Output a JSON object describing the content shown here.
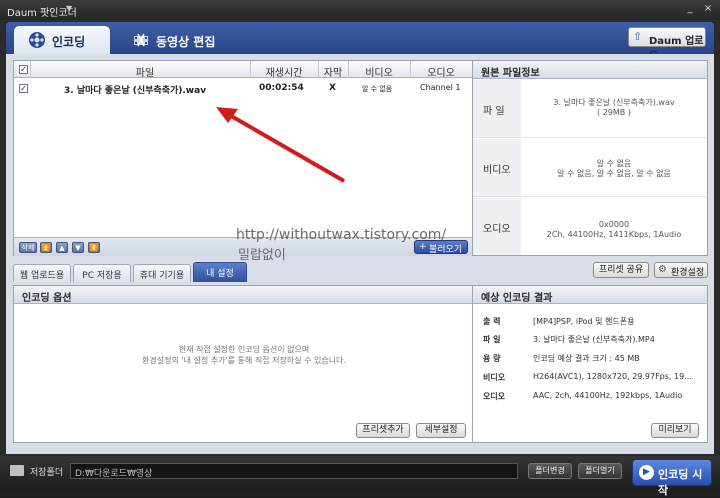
{
  "window": {
    "title": "Daum 팟인코더",
    "controls": {
      "minimize": "_",
      "close": "×"
    }
  },
  "main_tabs": {
    "encoding": "인코딩",
    "video_edit": "동영상 편집",
    "update_button": "Daum 업로드"
  },
  "file_list": {
    "columns": [
      "파일",
      "재생시간",
      "자막",
      "비디오",
      "오디오"
    ],
    "rows": [
      {
        "checked": true,
        "file": "3. 날마다 좋은날 (신부측축가).wav",
        "duration": "00:02:54",
        "subtitle": "X",
        "video": "알 수 없음",
        "audio": "Channel 1"
      }
    ],
    "footer": {
      "delete": "삭제",
      "browse_button": "불러오기"
    }
  },
  "original_info": {
    "title": "원본 파일정보",
    "rows": [
      {
        "label": "파 일",
        "value": "3. 날마다 좋은날 (신부측축가).wav\n( 29MB )"
      },
      {
        "label": "비디오",
        "value": "알 수 없음\n알 수 없음, 알 수 없음, 알 수 없음"
      },
      {
        "label": "오디오",
        "value": "0x0000\n2Ch, 44100Hz, 1411Kbps, 1Audio"
      }
    ]
  },
  "watermark": {
    "url": "http://withoutwax.tistory.com/",
    "name": "밀랍없이"
  },
  "option_tabs": [
    "웹 업로드용",
    "PC 저장용",
    "휴대 기기용",
    "내 설정"
  ],
  "option_buttons": {
    "preset_share": "프리셋 공유",
    "env_settings": "환경설정"
  },
  "encoding_options": {
    "title": "인코딩 옵션",
    "message_line1": "현재 직접 설정한 인코딩 옵션이 없으며",
    "message_line2": "환경설정의 '내 설정 추가'를 통해 직접 저장하실 수 있습니다.",
    "add_preset_button": "프리셋추가",
    "detail_button": "세부설정"
  },
  "expected_result": {
    "title": "예상 인코딩 결과",
    "rows": [
      {
        "label": "출 력",
        "value": "[MP4]PSP, iPod 및 핸드폰용"
      },
      {
        "label": "파 일",
        "value": "3. 날마다 좋은날 (신부측축가).MP4"
      },
      {
        "label": "용 량",
        "value": "인코딩 예상 결과 크기 : 45 MB"
      },
      {
        "label": "비디오",
        "value": "H264(AVC1), 1280x720, 29.97Fps, 19..."
      },
      {
        "label": "오디오",
        "value": "AAC, 2ch, 44100Hz, 192kbps, 1Audio"
      }
    ],
    "preview_button": "미리보기"
  },
  "bottom": {
    "folder_label": "저장폴더",
    "path": "D:₩다운로드₩영상",
    "change_folder": "폴더변경",
    "open_folder": "폴더열기",
    "start_button": "인코딩 시작"
  },
  "colors": {
    "accent_blue": "#2a4688",
    "arrow_red": "#d21c1c"
  }
}
